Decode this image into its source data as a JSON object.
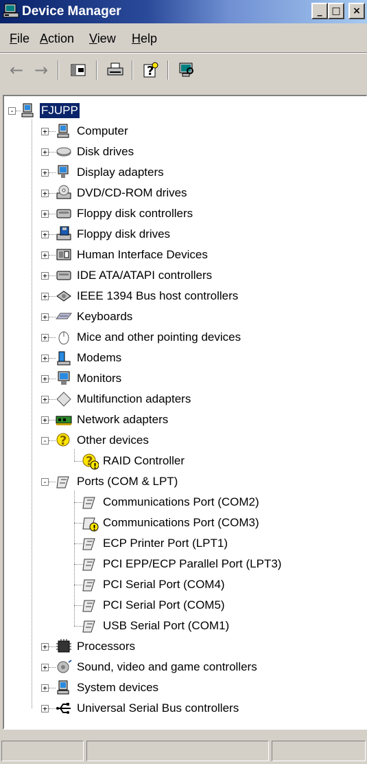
{
  "window": {
    "title": "Device Manager",
    "buttons": {
      "minimize": "_",
      "maximize": "□",
      "close": "×"
    }
  },
  "menu": [
    {
      "label": "File",
      "accel": "F"
    },
    {
      "label": "Action",
      "accel": "A"
    },
    {
      "label": "View",
      "accel": "V"
    },
    {
      "label": "Help",
      "accel": "H"
    }
  ],
  "toolbar": {
    "back": "←",
    "forward": "→"
  },
  "tree": {
    "root": "FJUPP",
    "items": [
      {
        "label": "Computer",
        "icon": "computer-icon",
        "expander": "+"
      },
      {
        "label": "Disk drives",
        "icon": "disk-drive-icon",
        "expander": "+"
      },
      {
        "label": "Display adapters",
        "icon": "display-adapter-icon",
        "expander": "+"
      },
      {
        "label": "DVD/CD-ROM drives",
        "icon": "cdrom-icon",
        "expander": "+"
      },
      {
        "label": "Floppy disk controllers",
        "icon": "controller-icon",
        "expander": "+"
      },
      {
        "label": "Floppy disk drives",
        "icon": "floppy-drive-icon",
        "expander": "+"
      },
      {
        "label": "Human Interface Devices",
        "icon": "hid-icon",
        "expander": "+"
      },
      {
        "label": "IDE ATA/ATAPI controllers",
        "icon": "controller-icon",
        "expander": "+"
      },
      {
        "label": "IEEE 1394 Bus host controllers",
        "icon": "ieee1394-icon",
        "expander": "+"
      },
      {
        "label": "Keyboards",
        "icon": "keyboard-icon",
        "expander": "+"
      },
      {
        "label": "Mice and other pointing devices",
        "icon": "mouse-icon",
        "expander": "+"
      },
      {
        "label": "Modems",
        "icon": "modem-icon",
        "expander": "+"
      },
      {
        "label": "Monitors",
        "icon": "monitor-icon",
        "expander": "+"
      },
      {
        "label": "Multifunction adapters",
        "icon": "multifunction-icon",
        "expander": "+"
      },
      {
        "label": "Network adapters",
        "icon": "network-adapter-icon",
        "expander": "+"
      },
      {
        "label": "Other devices",
        "icon": "unknown-device-icon",
        "expander": "-",
        "children": [
          {
            "label": "RAID Controller",
            "icon": "warning-device-icon"
          }
        ]
      },
      {
        "label": "Ports (COM & LPT)",
        "icon": "port-icon",
        "expander": "-",
        "children": [
          {
            "label": "Communications Port (COM2)",
            "icon": "port-icon"
          },
          {
            "label": "Communications Port (COM3)",
            "icon": "port-warning-icon"
          },
          {
            "label": "ECP Printer Port (LPT1)",
            "icon": "port-icon"
          },
          {
            "label": "PCI EPP/ECP Parallel Port (LPT3)",
            "icon": "port-icon"
          },
          {
            "label": "PCI Serial Port (COM4)",
            "icon": "port-icon"
          },
          {
            "label": "PCI Serial Port (COM5)",
            "icon": "port-icon"
          },
          {
            "label": "USB Serial Port (COM1)",
            "icon": "port-icon"
          }
        ]
      },
      {
        "label": "Processors",
        "icon": "processor-icon",
        "expander": "+"
      },
      {
        "label": "Sound, video and game controllers",
        "icon": "sound-icon",
        "expander": "+"
      },
      {
        "label": "System devices",
        "icon": "system-device-icon",
        "expander": "+"
      },
      {
        "label": "Universal Serial Bus controllers",
        "icon": "usb-icon",
        "expander": "+"
      }
    ]
  },
  "colors": {
    "selection": "#0a246a",
    "face": "#d4d0c8",
    "warning": "#ffe600"
  }
}
